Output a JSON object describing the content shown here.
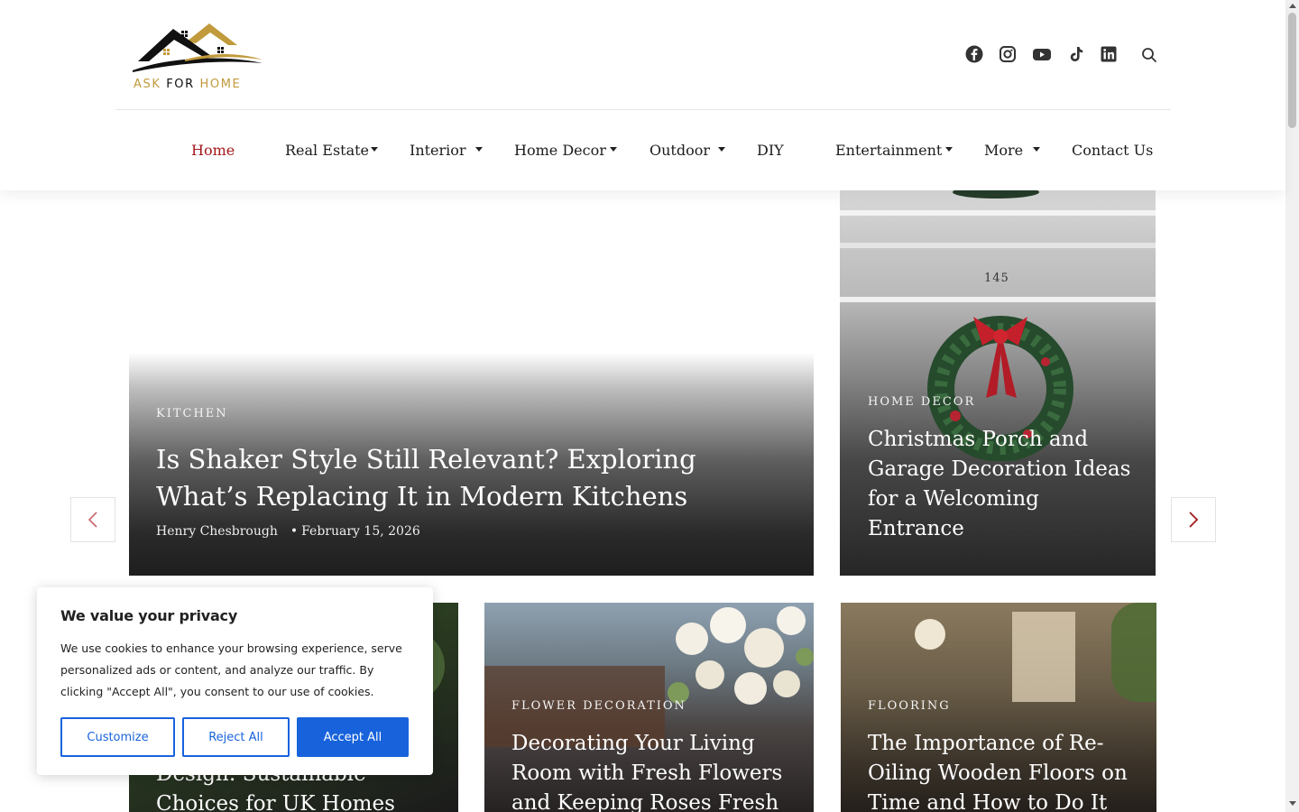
{
  "site": {
    "logo_text_ask": "ASK",
    "logo_text_for": "FOR",
    "logo_text_home": "HOME",
    "colors": {
      "brand_gold": "#c19a3b",
      "accent_red": "#a3191c",
      "cookie_blue": "#1863dc"
    }
  },
  "social_icons": [
    "facebook-icon",
    "instagram-icon",
    "youtube-icon",
    "tiktok-icon",
    "linkedin-icon",
    "search-icon"
  ],
  "nav": {
    "items": [
      {
        "label": "Home",
        "active": true,
        "has_dropdown": false
      },
      {
        "label": "Real Estate",
        "has_dropdown": true
      },
      {
        "label": "Interior",
        "has_dropdown": true
      },
      {
        "label": "Home Decor",
        "has_dropdown": true
      },
      {
        "label": "Outdoor",
        "has_dropdown": true
      },
      {
        "label": "DIY",
        "has_dropdown": false
      },
      {
        "label": "Entertainment",
        "has_dropdown": true
      },
      {
        "label": "More",
        "has_dropdown": true
      },
      {
        "label": "Contact Us",
        "has_dropdown": false
      }
    ]
  },
  "hero": {
    "main": {
      "category": "KITCHEN",
      "title": "Is Shaker Style Still Relevant? Exploring What’s Replacing It in Modern Kitchens",
      "author": "Henry Chesbrough",
      "date": "February 15, 2026"
    },
    "side": {
      "category": "HOME DECOR",
      "title": "Christmas Porch and Garage Decoration Ideas for a Welcoming Entrance",
      "house_number": "145"
    }
  },
  "cards": [
    {
      "category": "",
      "title": "Design: Sustainable Choices for UK Homes"
    },
    {
      "category": "FLOWER DECORATION",
      "title": "Decorating Your Living Room with Fresh Flowers and Keeping Roses Fresh"
    },
    {
      "category": "FLOORING",
      "title": "The Importance of Re-Oiling Wooden Floors on Time and How to Do It"
    }
  ],
  "cookie": {
    "title": "We value your privacy",
    "text": "We use cookies to enhance your browsing experience, serve personalized ads or content, and analyze our traffic. By clicking \"Accept All\", you consent to our use of cookies.",
    "customize": "Customize",
    "reject": "Reject All",
    "accept": "Accept All"
  }
}
